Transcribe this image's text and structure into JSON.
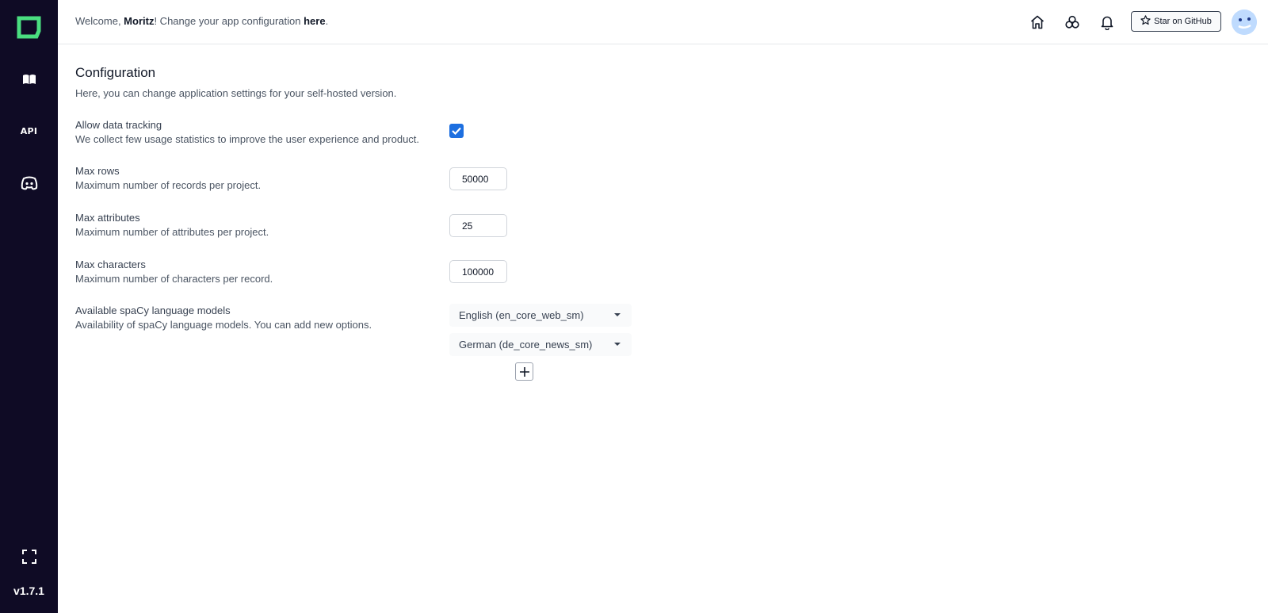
{
  "sidebar": {
    "version": "v1.7.1",
    "api_label": "API"
  },
  "header": {
    "welcome_prefix": "Welcome, ",
    "user_name": "Moritz",
    "welcome_middle": "! Change your app configuration ",
    "link_text": "here",
    "welcome_suffix": ".",
    "github_button": "Star on GitHub"
  },
  "main": {
    "title": "Configuration",
    "subtitle": "Here, you can change application settings for your self-hosted version.",
    "settings": [
      {
        "label": "Allow data tracking",
        "description": "We collect few usage statistics to improve the user experience and product.",
        "type": "checkbox",
        "checked": true
      },
      {
        "label": "Max rows",
        "description": "Maximum number of records per project.",
        "type": "number",
        "value": "50000"
      },
      {
        "label": "Max attributes",
        "description": "Maximum number of attributes per project.",
        "type": "number",
        "value": "25"
      },
      {
        "label": "Max characters",
        "description": "Maximum number of characters per record.",
        "type": "number",
        "value": "100000"
      },
      {
        "label": "Available spaCy language models",
        "description": "Availability of spaCy language models. You can add new options.",
        "type": "select-list",
        "options": [
          "English (en_core_web_sm)",
          "German (de_core_news_sm)"
        ]
      }
    ]
  },
  "colors": {
    "sidebar_bg": "#0f0b25",
    "logo_accent": "#4ade80",
    "checkbox_blue": "#1d6fe0"
  }
}
